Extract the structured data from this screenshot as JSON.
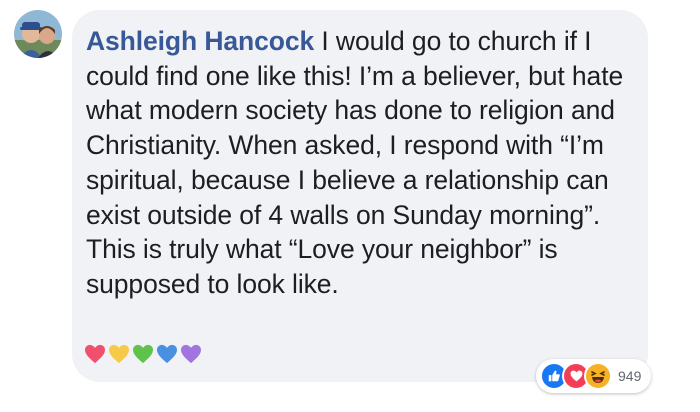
{
  "comment": {
    "author": "Ashleigh Hancock",
    "paragraphs": [
      " I would go to church if I could find one like this! I’m a believer, but hate what modern society has done to religion and Christianity. When asked, I respond with “I’m spiritual, because I believe a relationship can exist outside of 4 walls on Sunday morning”.",
      "This is truly what “Love your neighbor” is supposed to look like."
    ],
    "hearts": [
      {
        "name": "red-heart-icon",
        "color": "#f0506e"
      },
      {
        "name": "yellow-heart-icon",
        "color": "#f7c948"
      },
      {
        "name": "green-heart-icon",
        "color": "#5fc24a"
      },
      {
        "name": "blue-heart-icon",
        "color": "#4a90e2"
      },
      {
        "name": "purple-heart-icon",
        "color": "#a274e0"
      }
    ],
    "reactions": {
      "icons": [
        "like-reaction-icon",
        "love-reaction-icon",
        "haha-reaction-icon"
      ],
      "count": "949"
    }
  },
  "colors": {
    "author": "#385898",
    "bubble": "#f1f2f5",
    "like": "#1877f2",
    "love": "#f33e58",
    "haha": "#f7b125"
  }
}
